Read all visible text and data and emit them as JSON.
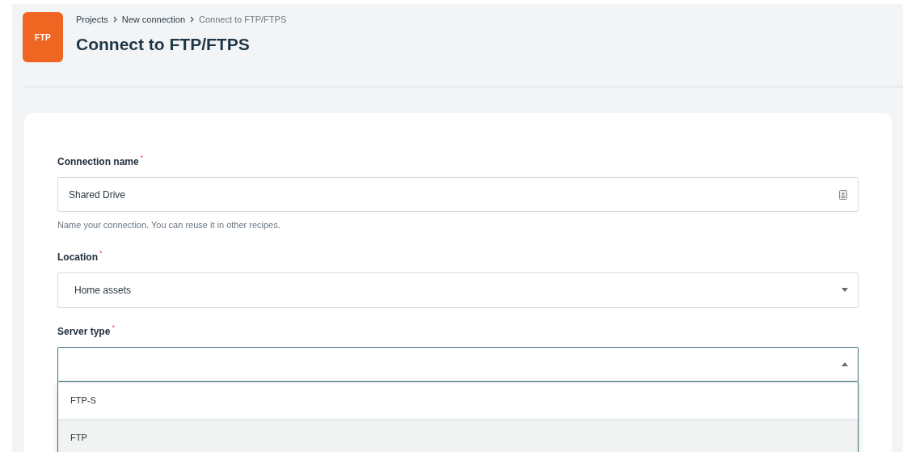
{
  "header": {
    "logo": "FTP",
    "breadcrumbs": [
      {
        "label": "Projects",
        "current": false
      },
      {
        "label": "New connection",
        "current": false
      },
      {
        "label": "Connect to FTP/FTPS",
        "current": true
      }
    ],
    "title": "Connect to FTP/FTPS"
  },
  "form": {
    "fields": [
      {
        "kind": "text",
        "label": "Connection name",
        "required_mark": "*",
        "value": "Shared Drive",
        "help": "Name your connection. You can reuse it in other recipes."
      },
      {
        "kind": "select",
        "label": "Location",
        "required_mark": "*",
        "value": "Home assets",
        "expanded": false
      },
      {
        "kind": "select",
        "label": "Server type",
        "required_mark": "*",
        "expanded": true,
        "options": [
          {
            "label": "FTP-S",
            "selected": false
          },
          {
            "label": "FTP",
            "selected": true
          }
        ]
      }
    ]
  }
}
